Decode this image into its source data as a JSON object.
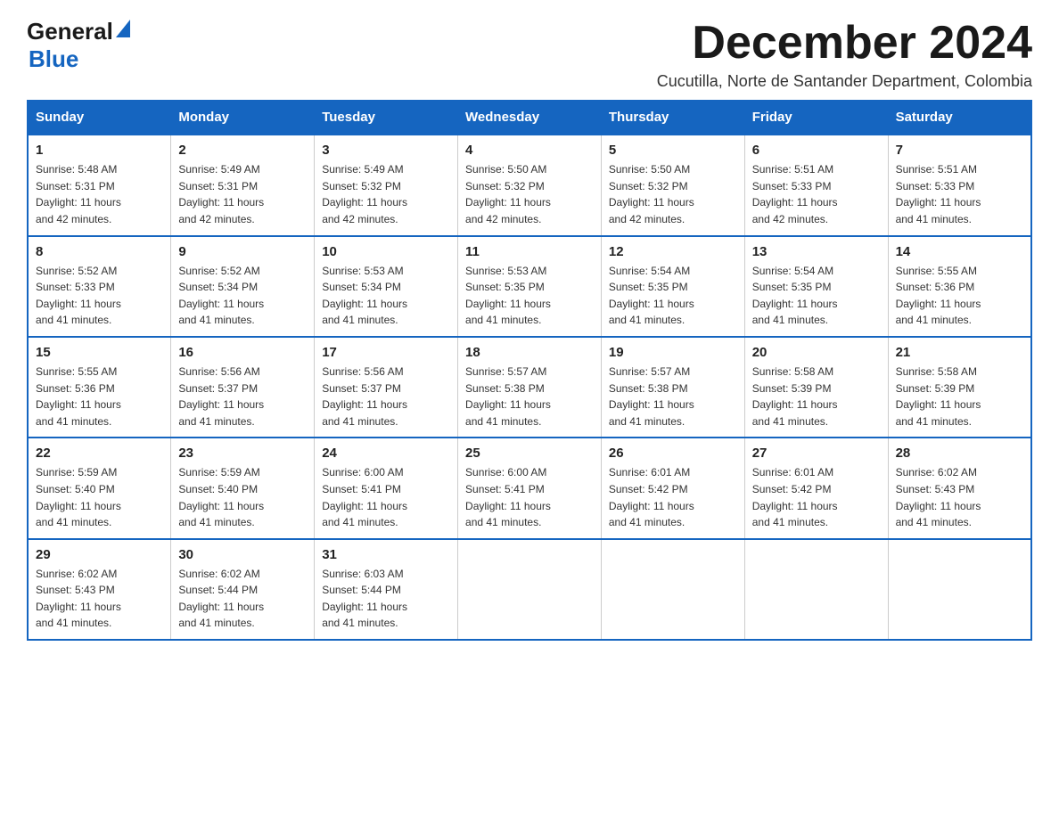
{
  "header": {
    "logo_general": "General",
    "logo_triangle": "▶",
    "logo_blue": "Blue",
    "month_title": "December 2024",
    "subtitle": "Cucutilla, Norte de Santander Department, Colombia"
  },
  "weekdays": [
    "Sunday",
    "Monday",
    "Tuesday",
    "Wednesday",
    "Thursday",
    "Friday",
    "Saturday"
  ],
  "weeks": [
    [
      {
        "day": "1",
        "sunrise": "5:48 AM",
        "sunset": "5:31 PM",
        "daylight": "11 hours and 42 minutes."
      },
      {
        "day": "2",
        "sunrise": "5:49 AM",
        "sunset": "5:31 PM",
        "daylight": "11 hours and 42 minutes."
      },
      {
        "day": "3",
        "sunrise": "5:49 AM",
        "sunset": "5:32 PM",
        "daylight": "11 hours and 42 minutes."
      },
      {
        "day": "4",
        "sunrise": "5:50 AM",
        "sunset": "5:32 PM",
        "daylight": "11 hours and 42 minutes."
      },
      {
        "day": "5",
        "sunrise": "5:50 AM",
        "sunset": "5:32 PM",
        "daylight": "11 hours and 42 minutes."
      },
      {
        "day": "6",
        "sunrise": "5:51 AM",
        "sunset": "5:33 PM",
        "daylight": "11 hours and 42 minutes."
      },
      {
        "day": "7",
        "sunrise": "5:51 AM",
        "sunset": "5:33 PM",
        "daylight": "11 hours and 41 minutes."
      }
    ],
    [
      {
        "day": "8",
        "sunrise": "5:52 AM",
        "sunset": "5:33 PM",
        "daylight": "11 hours and 41 minutes."
      },
      {
        "day": "9",
        "sunrise": "5:52 AM",
        "sunset": "5:34 PM",
        "daylight": "11 hours and 41 minutes."
      },
      {
        "day": "10",
        "sunrise": "5:53 AM",
        "sunset": "5:34 PM",
        "daylight": "11 hours and 41 minutes."
      },
      {
        "day": "11",
        "sunrise": "5:53 AM",
        "sunset": "5:35 PM",
        "daylight": "11 hours and 41 minutes."
      },
      {
        "day": "12",
        "sunrise": "5:54 AM",
        "sunset": "5:35 PM",
        "daylight": "11 hours and 41 minutes."
      },
      {
        "day": "13",
        "sunrise": "5:54 AM",
        "sunset": "5:35 PM",
        "daylight": "11 hours and 41 minutes."
      },
      {
        "day": "14",
        "sunrise": "5:55 AM",
        "sunset": "5:36 PM",
        "daylight": "11 hours and 41 minutes."
      }
    ],
    [
      {
        "day": "15",
        "sunrise": "5:55 AM",
        "sunset": "5:36 PM",
        "daylight": "11 hours and 41 minutes."
      },
      {
        "day": "16",
        "sunrise": "5:56 AM",
        "sunset": "5:37 PM",
        "daylight": "11 hours and 41 minutes."
      },
      {
        "day": "17",
        "sunrise": "5:56 AM",
        "sunset": "5:37 PM",
        "daylight": "11 hours and 41 minutes."
      },
      {
        "day": "18",
        "sunrise": "5:57 AM",
        "sunset": "5:38 PM",
        "daylight": "11 hours and 41 minutes."
      },
      {
        "day": "19",
        "sunrise": "5:57 AM",
        "sunset": "5:38 PM",
        "daylight": "11 hours and 41 minutes."
      },
      {
        "day": "20",
        "sunrise": "5:58 AM",
        "sunset": "5:39 PM",
        "daylight": "11 hours and 41 minutes."
      },
      {
        "day": "21",
        "sunrise": "5:58 AM",
        "sunset": "5:39 PM",
        "daylight": "11 hours and 41 minutes."
      }
    ],
    [
      {
        "day": "22",
        "sunrise": "5:59 AM",
        "sunset": "5:40 PM",
        "daylight": "11 hours and 41 minutes."
      },
      {
        "day": "23",
        "sunrise": "5:59 AM",
        "sunset": "5:40 PM",
        "daylight": "11 hours and 41 minutes."
      },
      {
        "day": "24",
        "sunrise": "6:00 AM",
        "sunset": "5:41 PM",
        "daylight": "11 hours and 41 minutes."
      },
      {
        "day": "25",
        "sunrise": "6:00 AM",
        "sunset": "5:41 PM",
        "daylight": "11 hours and 41 minutes."
      },
      {
        "day": "26",
        "sunrise": "6:01 AM",
        "sunset": "5:42 PM",
        "daylight": "11 hours and 41 minutes."
      },
      {
        "day": "27",
        "sunrise": "6:01 AM",
        "sunset": "5:42 PM",
        "daylight": "11 hours and 41 minutes."
      },
      {
        "day": "28",
        "sunrise": "6:02 AM",
        "sunset": "5:43 PM",
        "daylight": "11 hours and 41 minutes."
      }
    ],
    [
      {
        "day": "29",
        "sunrise": "6:02 AM",
        "sunset": "5:43 PM",
        "daylight": "11 hours and 41 minutes."
      },
      {
        "day": "30",
        "sunrise": "6:02 AM",
        "sunset": "5:44 PM",
        "daylight": "11 hours and 41 minutes."
      },
      {
        "day": "31",
        "sunrise": "6:03 AM",
        "sunset": "5:44 PM",
        "daylight": "11 hours and 41 minutes."
      },
      null,
      null,
      null,
      null
    ]
  ],
  "labels": {
    "sunrise": "Sunrise:",
    "sunset": "Sunset:",
    "daylight": "Daylight:"
  }
}
